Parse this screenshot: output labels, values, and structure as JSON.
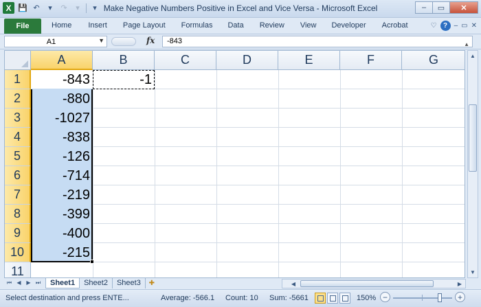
{
  "window": {
    "title": "Make Negative Numbers Positive in Excel and Vice Versa  -  Microsoft Excel",
    "app_icon": "X",
    "minimize": "–",
    "restore": "▭",
    "close": "✕"
  },
  "quick_access": {
    "save_icon": "💾",
    "undo_icon": "↶",
    "redo_icon": "↷",
    "dropdown_icon": "▾"
  },
  "ribbon": {
    "file_label": "File",
    "tabs": [
      "Home",
      "Insert",
      "Page Layout",
      "Formulas",
      "Data",
      "Review",
      "View",
      "Developer",
      "Acrobat"
    ],
    "help_label": "?",
    "ribbon_collapse": "♡"
  },
  "formula_bar": {
    "name_box": "A1",
    "fx_label": "fx",
    "value": "-843"
  },
  "columns": [
    "A",
    "B",
    "C",
    "D",
    "E",
    "F",
    "G"
  ],
  "rows": [
    "1",
    "2",
    "3",
    "4",
    "5",
    "6",
    "7",
    "8",
    "9",
    "10",
    "11"
  ],
  "cells": {
    "A": [
      "-843",
      "-880",
      "-1027",
      "-838",
      "-126",
      "-714",
      "-219",
      "-399",
      "-400",
      "-215"
    ],
    "B1": "-1"
  },
  "sheets": {
    "tabs": [
      "Sheet1",
      "Sheet2",
      "Sheet3"
    ],
    "active": "Sheet1",
    "nav": [
      "⏮",
      "◀",
      "▶",
      "⏭"
    ]
  },
  "status": {
    "message": "Select destination and press ENTE...",
    "average": "Average: -566.1",
    "count": "Count: 10",
    "sum": "Sum: -5661",
    "zoom": "150%",
    "zoom_level_percent": 150
  },
  "colors": {
    "selection_fill": "#c6dcf3",
    "header_highlight": "#f9d36b",
    "file_tab": "#2b7a3b"
  }
}
